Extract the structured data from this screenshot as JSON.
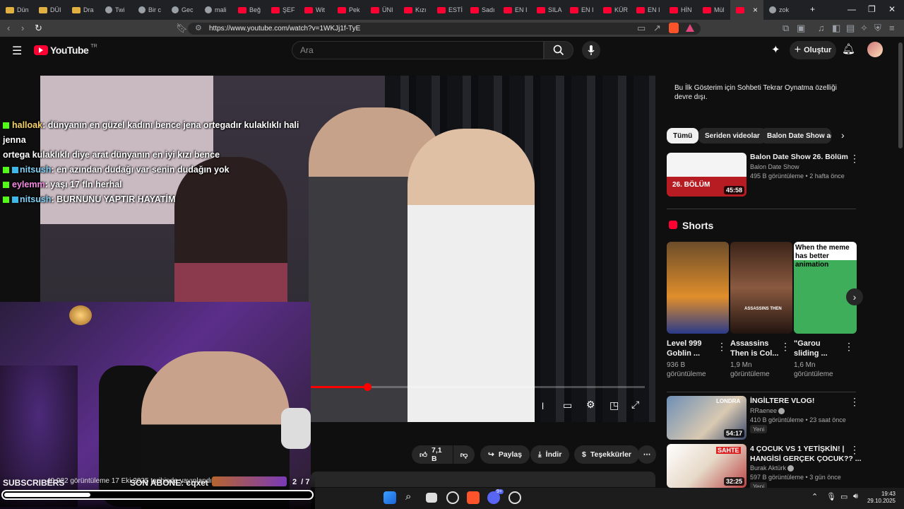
{
  "browser": {
    "tabs": [
      {
        "label": "Dün"
      },
      {
        "label": "DÜI"
      },
      {
        "label": "Dra"
      },
      {
        "label": "Twi"
      },
      {
        "label": "Bir c"
      },
      {
        "label": "Gec"
      },
      {
        "label": "mali"
      },
      {
        "label": "Beğ"
      },
      {
        "label": "ŞEF"
      },
      {
        "label": "Wit"
      },
      {
        "label": "Pek"
      },
      {
        "label": "ÜNI"
      },
      {
        "label": "Kızı"
      },
      {
        "label": "ESTİ"
      },
      {
        "label": "Sadı"
      },
      {
        "label": "EN I"
      },
      {
        "label": "SILA"
      },
      {
        "label": "EN I"
      },
      {
        "label": "KÜR"
      },
      {
        "label": "EN I"
      },
      {
        "label": "HİN"
      },
      {
        "label": "Mül"
      },
      {
        "label": ""
      },
      {
        "label": "zok"
      }
    ],
    "url": "https://www.youtube.com/watch?v=1WKJj1f-TyE"
  },
  "youtube": {
    "logo_text": "YouTube",
    "logo_region": "TR",
    "search_placeholder": "Ara",
    "create_label": "Oluştur"
  },
  "chat": [
    {
      "user": "halloak",
      "text": ": dünyanın en güzel kadını bence jena ortegadır kulaklıklı hali jenna",
      "cont": "ortega kulaklıklı diye arat dünyanın en iyi kızı bence",
      "sub": false
    },
    {
      "user": "nitsush",
      "text": ": en azından dudağı var senin dudağın yok",
      "sub": true
    },
    {
      "user": "eylemm",
      "text": ": yaşı 17 fln herhal",
      "sub": false
    },
    {
      "user": "nitsush",
      "text": ": BURNUNU YAPTIR HAYATİM",
      "sub": true
    }
  ],
  "stream_overlay": {
    "subscribers_label": "SUBSCRIBERS",
    "last_sub": "SON ABONE: cqxet",
    "counter": "2  / 7",
    "behind_text": "40.922 görüntüleme  17 Eki 2025 tarihinde yayınlandı",
    "progress": 0.28
  },
  "actions": {
    "likes": "7,1 B",
    "share": "Paylaş",
    "download": "İndir",
    "thanks": "Teşekkürler"
  },
  "sidebar": {
    "chat_notice": "Bu İlk Gösterim için Sohbeti Tekrar Oynatma özelliği devre dışı.",
    "chips": [
      "Tümü",
      "Seriden videolar",
      "Balon Date Show adlı"
    ],
    "top_video": {
      "title": "Balon Date Show 26. Bölüm",
      "channel": "Balon Date Show",
      "meta": "495 B görüntüleme • 2 hafta önce",
      "duration": "45:58",
      "thumb_text": "26. BÖLÜM"
    },
    "shorts_heading": "Shorts",
    "shorts": [
      {
        "title1": "Level 999",
        "title2": "Goblin ...",
        "views1": "936 B",
        "views2": "görüntüleme"
      },
      {
        "title1": "Assassins",
        "title2": "Then is Col...",
        "views1": "1,9 Mn",
        "views2": "görüntüleme",
        "thumb_text": "ASSASSINS THEN"
      },
      {
        "title1": "\"Garou",
        "title2": "sliding ...",
        "views1": "1,6 Mn",
        "views2": "görüntüleme",
        "thumb_text": "When the meme has better animation"
      }
    ],
    "videos": [
      {
        "title": "İNGİLTERE VLOG!",
        "title2": "",
        "channel": "RRaenee",
        "meta": "410 B görüntüleme • 23 saat önce",
        "badge": "Yeni",
        "duration": "54:17",
        "thumb_text": "LONDRA"
      },
      {
        "title": "4 ÇOCUK VS 1 YETİŞKİN! |",
        "title2": "HANGİSİ GERÇEK ÇOCUK?? ...",
        "channel": "Burak Aktürk",
        "meta": "597 B görüntüleme • 3 gün önce",
        "badge": "Yeni",
        "duration": "32:25",
        "thumb_text": "SAHTE"
      }
    ]
  },
  "taskbar": {
    "time": "19:43",
    "date": "29.10.2025",
    "messenger_badge": "9+"
  },
  "colors": {
    "bg": "#0f0f0f",
    "accent": "#ff0000",
    "chat_green": "#53fc18"
  }
}
